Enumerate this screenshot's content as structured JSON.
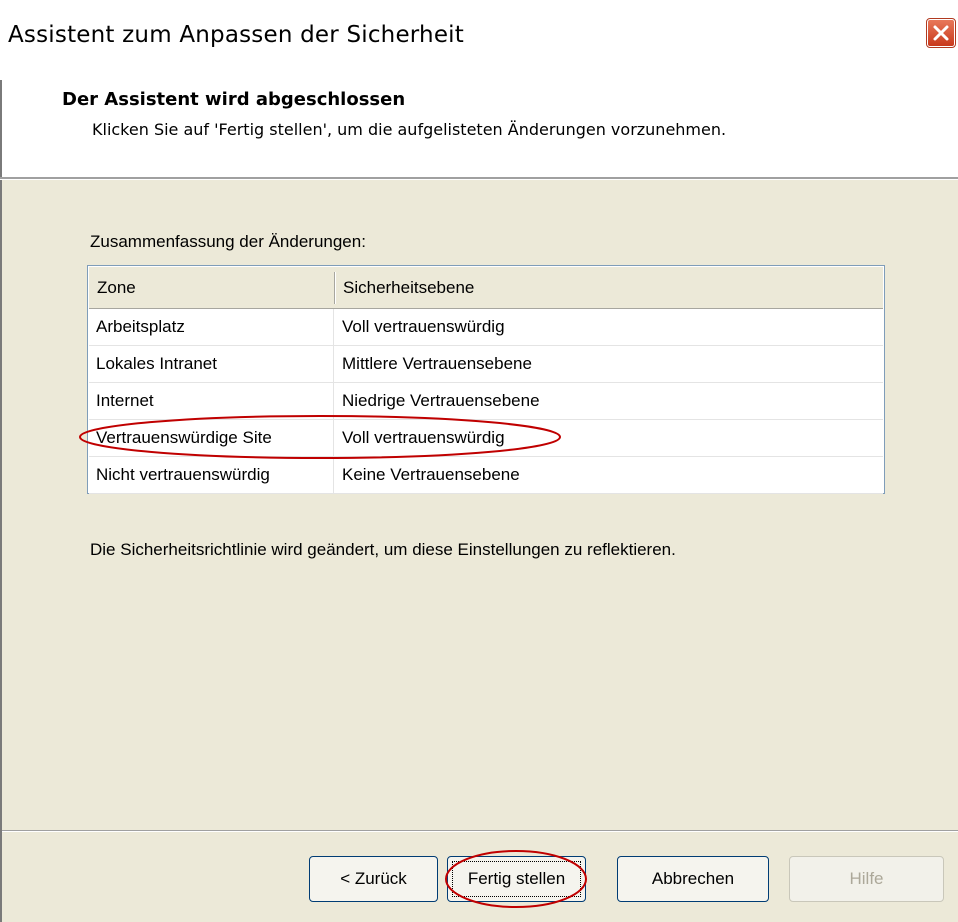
{
  "window": {
    "title": "Assistent zum Anpassen der Sicherheit",
    "close_icon": "close-icon"
  },
  "header": {
    "title": "Der Assistent wird abgeschlossen",
    "description": "Klicken Sie auf 'Fertig stellen', um die aufgelisteten Änderungen vorzunehmen."
  },
  "summary": {
    "label": "Zusammenfassung der Änderungen:",
    "columns": [
      "Zone",
      "Sicherheitsebene"
    ],
    "rows": [
      {
        "zone": "Arbeitsplatz",
        "level": "Voll vertrauenswürdig"
      },
      {
        "zone": "Lokales Intranet",
        "level": "Mittlere Vertrauensebene"
      },
      {
        "zone": "Internet",
        "level": "Niedrige Vertrauensebene"
      },
      {
        "zone": "Vertrauenswürdige Site",
        "level": "Voll vertrauenswürdig"
      },
      {
        "zone": "Nicht vertrauenswürdig",
        "level": "Keine Vertrauensebene"
      }
    ]
  },
  "info_text": "Die Sicherheitsrichtlinie wird geändert, um diese Einstellungen zu reflektieren.",
  "buttons": {
    "back": "< Zurück",
    "finish": "Fertig stellen",
    "cancel": "Abbrechen",
    "help": "Hilfe"
  },
  "colors": {
    "dialog_face": "#ece9d8",
    "annotation": "#c00000",
    "close_button": "#c8391c"
  }
}
